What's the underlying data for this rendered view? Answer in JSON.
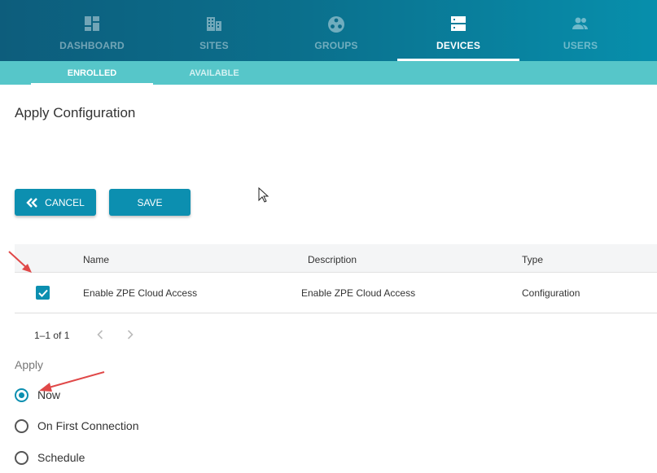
{
  "nav": {
    "items": [
      {
        "label": "DASHBOARD",
        "icon": "dashboard-icon"
      },
      {
        "label": "SITES",
        "icon": "building-icon"
      },
      {
        "label": "GROUPS",
        "icon": "groups-icon"
      },
      {
        "label": "DEVICES",
        "icon": "server-icon"
      },
      {
        "label": "USERS",
        "icon": "users-icon"
      }
    ],
    "active": "DEVICES"
  },
  "subnav": {
    "items": [
      {
        "label": "ENROLLED"
      },
      {
        "label": "AVAILABLE"
      }
    ],
    "active": "ENROLLED"
  },
  "page": {
    "title": "Apply Configuration"
  },
  "actions": {
    "cancel_label": "CANCEL",
    "save_label": "SAVE"
  },
  "table": {
    "columns": [
      "Name",
      "Description",
      "Type"
    ],
    "rows": [
      {
        "checked": true,
        "name": "Enable ZPE Cloud Access",
        "description": "Enable ZPE Cloud Access",
        "type": "Configuration"
      }
    ]
  },
  "pagination": {
    "text": "1–1 of 1"
  },
  "apply": {
    "label": "Apply",
    "options": [
      {
        "label": "Now",
        "selected": true
      },
      {
        "label": "On First Connection",
        "selected": false
      },
      {
        "label": "Schedule",
        "selected": false
      }
    ]
  },
  "colors": {
    "nav_dark": "#0d5d7c",
    "nav_light": "#078fac",
    "subnav": "#56c6c9",
    "accent": "#0c8fb0",
    "annotation_arrow": "#e04848"
  }
}
